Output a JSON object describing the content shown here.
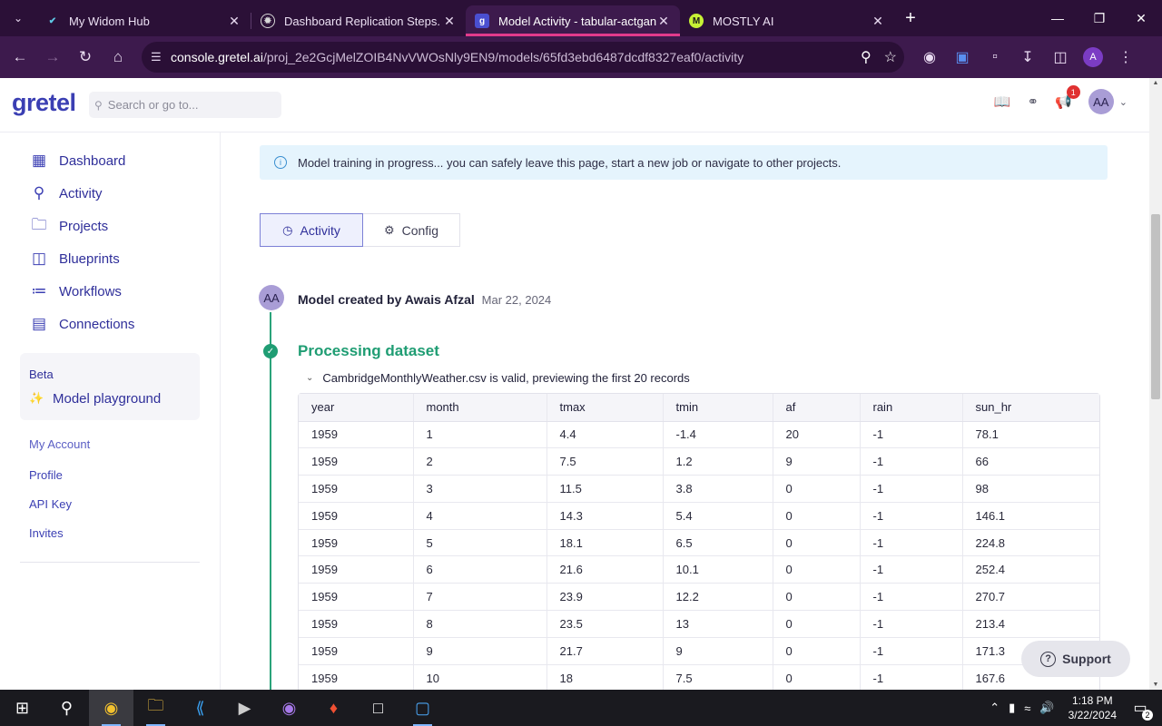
{
  "browser": {
    "tabs": [
      {
        "title": "My Widom Hub",
        "favicon": "widom-icon",
        "active": false
      },
      {
        "title": "Dashboard Replication Steps.",
        "favicon": "chatgpt-icon",
        "active": false
      },
      {
        "title": "Model Activity - tabular-actgan",
        "favicon": "gretel-icon",
        "active": true
      },
      {
        "title": "MOSTLY AI",
        "favicon": "mostly-icon",
        "active": false
      }
    ],
    "url_host": "console.gretel.ai",
    "url_path": "/proj_2e2GcjMelZOIB4NvVWOsNly9EN9/models/65fd3ebd6487dcdf8327eaf0/activity",
    "profile_initial": "A",
    "accent": "#3d1a4d",
    "tab_indicator": "#e23b8c"
  },
  "app": {
    "logo": "gretel",
    "search_placeholder": "Search or go to...",
    "notification_count": "1",
    "user_initials": "AA",
    "brand_color": "#3b3fb3"
  },
  "sidebar": {
    "items": [
      {
        "label": "Dashboard",
        "icon": "dashboard-icon"
      },
      {
        "label": "Activity",
        "icon": "binoculars-icon"
      },
      {
        "label": "Projects",
        "icon": "folder-icon"
      },
      {
        "label": "Blueprints",
        "icon": "blueprint-icon"
      },
      {
        "label": "Workflows",
        "icon": "workflow-icon"
      },
      {
        "label": "Connections",
        "icon": "connections-icon"
      }
    ],
    "beta_label": "Beta",
    "beta_item": "Model playground",
    "account_heading": "My Account",
    "account_links": [
      "Profile",
      "API Key",
      "Invites"
    ]
  },
  "main": {
    "banner": "Model training in progress... you can safely leave this page, start a new job or navigate to other projects.",
    "tabs": [
      {
        "label": "Activity",
        "active": true
      },
      {
        "label": "Config",
        "active": false
      }
    ],
    "created_text": "Model created by Awais Afzal",
    "created_date": "Mar 22, 2024",
    "creator_initials": "AA",
    "step_title": "Processing dataset",
    "step_status_color": "#1f9d73",
    "valid_text": "CambridgeMonthlyWeather.csv is valid, previewing the first 20 records",
    "table": {
      "columns": [
        "year",
        "month",
        "tmax",
        "tmin",
        "af",
        "rain",
        "sun_hr"
      ],
      "rows": [
        [
          "1959",
          "1",
          "4.4",
          "-1.4",
          "20",
          "-1",
          "78.1"
        ],
        [
          "1959",
          "2",
          "7.5",
          "1.2",
          "9",
          "-1",
          "66"
        ],
        [
          "1959",
          "3",
          "11.5",
          "3.8",
          "0",
          "-1",
          "98"
        ],
        [
          "1959",
          "4",
          "14.3",
          "5.4",
          "0",
          "-1",
          "146.1"
        ],
        [
          "1959",
          "5",
          "18.1",
          "6.5",
          "0",
          "-1",
          "224.8"
        ],
        [
          "1959",
          "6",
          "21.6",
          "10.1",
          "0",
          "-1",
          "252.4"
        ],
        [
          "1959",
          "7",
          "23.9",
          "12.2",
          "0",
          "-1",
          "270.7"
        ],
        [
          "1959",
          "8",
          "23.5",
          "13",
          "0",
          "-1",
          "213.4"
        ],
        [
          "1959",
          "9",
          "21.7",
          "9",
          "0",
          "-1",
          "171.3"
        ],
        [
          "1959",
          "10",
          "18",
          "7.5",
          "0",
          "-1",
          "167.6"
        ]
      ]
    },
    "support_label": "Support"
  },
  "taskbar": {
    "time": "1:18 PM",
    "date": "3/22/2024",
    "notification_count": "2"
  }
}
